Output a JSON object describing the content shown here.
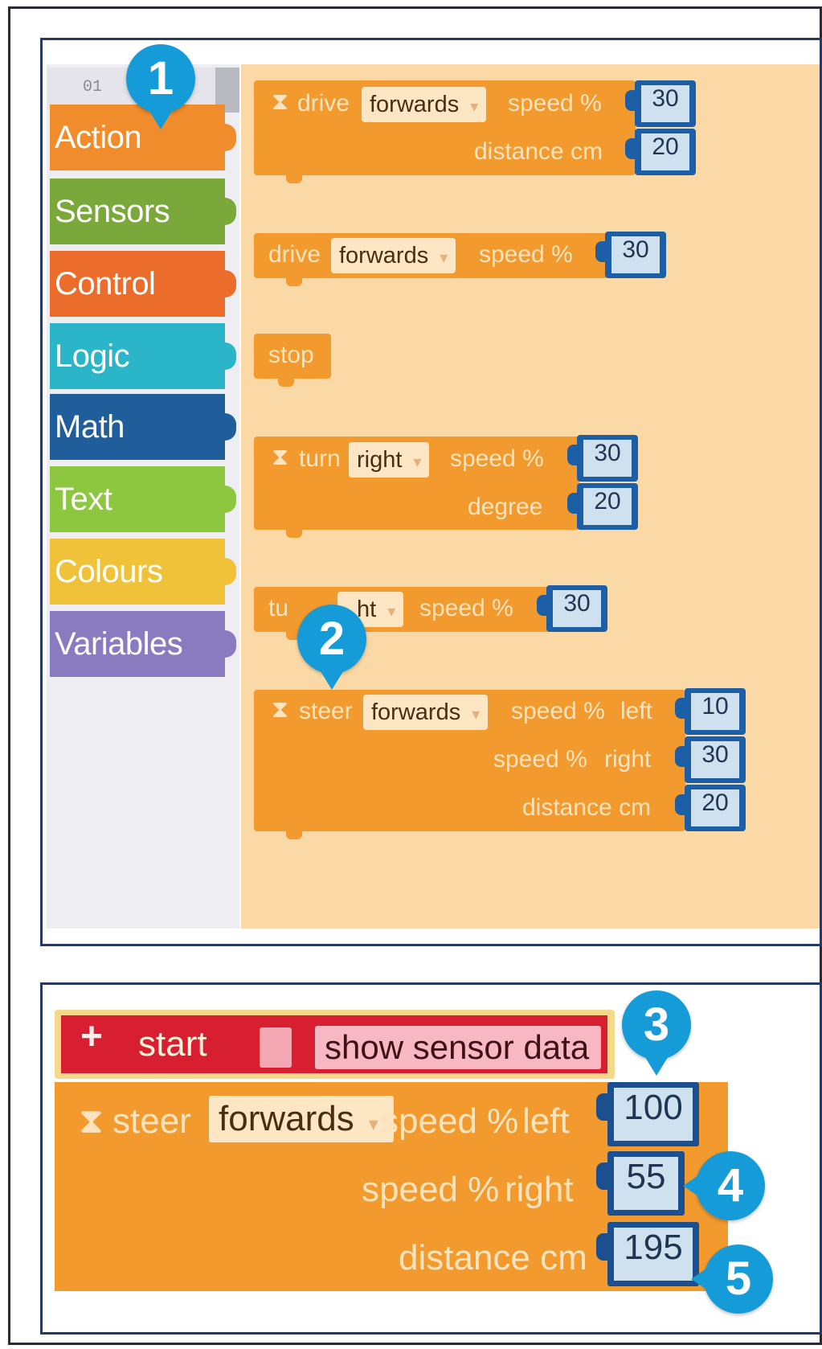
{
  "toolbox": {
    "tab_label": "01",
    "categories": [
      {
        "label": "Action",
        "color": "#f08c2c"
      },
      {
        "label": "Sensors",
        "color": "#7aa83a"
      },
      {
        "label": "Control",
        "color": "#ec6c2c"
      },
      {
        "label": "Logic",
        "color": "#2ab6c8"
      },
      {
        "label": "Math",
        "color": "#1f5e9a"
      },
      {
        "label": "Text",
        "color": "#8dc63f"
      },
      {
        "label": "Colours",
        "color": "#f0c23a"
      },
      {
        "label": "Variables",
        "color": "#8a7ac0"
      }
    ]
  },
  "workspace": {
    "block1": {
      "verb": "drive",
      "direction": "forwards",
      "speed_label": "speed %",
      "speed": "30",
      "distance_label": "distance cm",
      "distance": "20"
    },
    "block2": {
      "verb": "drive",
      "direction": "forwards",
      "speed_label": "speed %",
      "speed": "30"
    },
    "block3": {
      "verb": "stop"
    },
    "block4": {
      "verb": "turn",
      "direction": "right",
      "speed_label": "speed %",
      "speed": "30",
      "degree_label": "degree",
      "degree": "20"
    },
    "block5": {
      "verb": "tu",
      "direction": "ht",
      "speed_label": "speed %",
      "speed": "30"
    },
    "block6": {
      "verb": "steer",
      "direction": "forwards",
      "speed_left_label": "speed %",
      "left_label": "left",
      "left": "10",
      "speed_right_label": "speed %",
      "right_label": "right",
      "right": "30",
      "distance_label": "distance cm",
      "distance": "20"
    }
  },
  "program": {
    "plus": "+",
    "start_label": "start",
    "sensor_button": "show sensor data",
    "steer": {
      "verb": "steer",
      "direction": "forwards",
      "speed_left_label": "speed %",
      "left_label": "left",
      "left": "100",
      "speed_right_label": "speed %",
      "right_label": "right",
      "right": "55",
      "distance_label": "distance cm",
      "distance": "195"
    }
  },
  "markers": [
    "1",
    "2",
    "3",
    "4",
    "5"
  ],
  "colors": {
    "block": "#f29a2e",
    "workspace": "#fbd9a7",
    "value_border": "#1c5fa7",
    "marker": "#159bd8",
    "hat": "#d81f32"
  }
}
